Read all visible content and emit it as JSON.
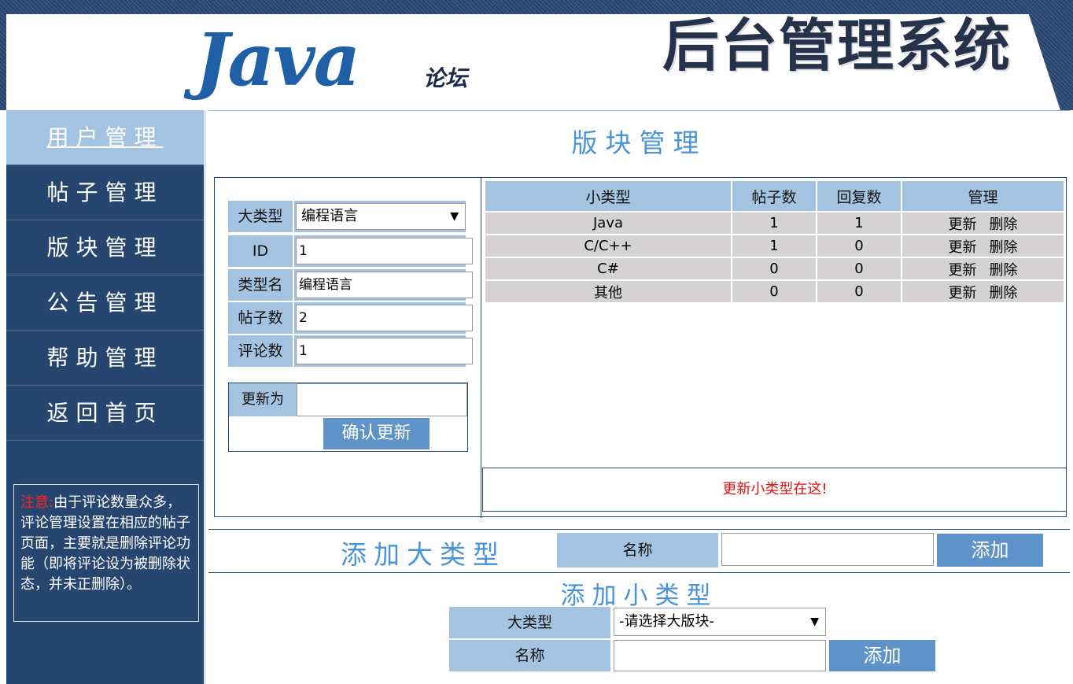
{
  "header": {
    "logo_main": "Java",
    "logo_sub": "论坛",
    "system_title": "后台管理系统"
  },
  "sidebar": {
    "items": [
      {
        "label": "用户管理",
        "active": true
      },
      {
        "label": "帖子管理",
        "active": false
      },
      {
        "label": "版块管理",
        "active": false
      },
      {
        "label": "公告管理",
        "active": false
      },
      {
        "label": "帮助管理",
        "active": false
      },
      {
        "label": "返回首页",
        "active": false
      }
    ],
    "notice_prefix": "注意:",
    "notice_text": "由于评论数量众多，评论管理设置在相应的帖子页面，主要就是删除评论功能（即将评论设为被删除状态，并未正删除）。"
  },
  "main": {
    "title": "版块管理",
    "form": {
      "category_label": "大类型",
      "category_value": "编程语言",
      "id_label": "ID",
      "id_value": "1",
      "typename_label": "类型名",
      "typename_value": "编程语言",
      "posts_label": "帖子数",
      "posts_value": "2",
      "comments_label": "评论数",
      "comments_value": "1",
      "update_label": "更新为",
      "update_value": "",
      "confirm_button": "确认更新"
    },
    "table": {
      "headers": [
        "小类型",
        "帖子数",
        "回复数",
        "管理"
      ],
      "rows": [
        {
          "name": "Java",
          "posts": "1",
          "replies": "1"
        },
        {
          "name": "C/C++",
          "posts": "1",
          "replies": "0"
        },
        {
          "name": "C#",
          "posts": "0",
          "replies": "0"
        },
        {
          "name": "其他",
          "posts": "0",
          "replies": "0"
        }
      ],
      "action_update": "更新",
      "action_delete": "删除",
      "update_hint": "更新小类型在这!"
    },
    "add_big": {
      "title": "添加大类型",
      "name_label": "名称",
      "name_value": "",
      "add_button": "添加"
    },
    "add_small": {
      "title": "添加小类型",
      "category_label": "大类型",
      "category_value": "-请选择大版块-",
      "name_label": "名称",
      "name_value": "",
      "add_button": "添加"
    }
  }
}
